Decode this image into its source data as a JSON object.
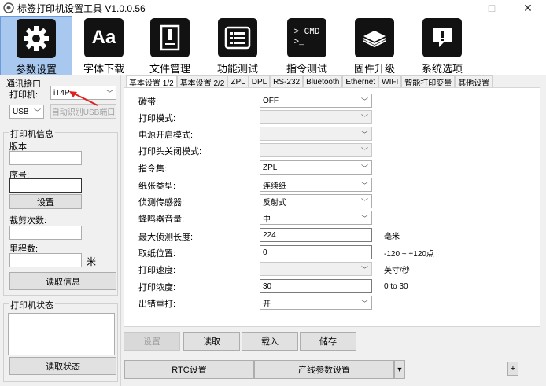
{
  "window": {
    "title": "标签打印机设置工具 V1.0.0.56",
    "minimize": "—",
    "maximize": "□",
    "close": "✕"
  },
  "toolbar": [
    {
      "label": "参数设置",
      "icon": "gear-icon",
      "active": true
    },
    {
      "label": "字体下载",
      "icon": "font-icon"
    },
    {
      "label": "文件管理",
      "icon": "file-icon"
    },
    {
      "label": "功能测试",
      "icon": "list-icon"
    },
    {
      "label": "指令测试",
      "icon": "cmd-icon",
      "icon_text": "> CMD\n>_"
    },
    {
      "label": "固件升级",
      "icon": "chip-icon"
    },
    {
      "label": "系统选项",
      "icon": "alert-icon"
    }
  ],
  "left": {
    "comm_group": "通讯接口",
    "printer_label": "打印机:",
    "printer_value": "iT4P",
    "port_value": "USB",
    "auto_detect": "自动识别USB端口",
    "info_group": "打印机信息",
    "version_label": "版本:",
    "version_value": "",
    "serial_label": "序号:",
    "serial_value": "",
    "set_button": "设置",
    "cut_label": "裁剪次数:",
    "cut_value": "",
    "mileage_label": "里程数:",
    "mileage_value": "",
    "mileage_unit": "米",
    "read_info": "读取信息",
    "status_group": "打印机状态",
    "status_value": "",
    "read_status": "读取状态"
  },
  "tabs": [
    "基本设置 1/2",
    "基本设置 2/2",
    "ZPL",
    "DPL",
    "RS-232",
    "Bluetooth",
    "Ethernet",
    "WIFI",
    "智能打印变量",
    "其他设置"
  ],
  "form": {
    "rows": [
      {
        "label": "碳带:",
        "type": "select",
        "value": "OFF"
      },
      {
        "label": "打印模式:",
        "type": "select-dis",
        "value": ""
      },
      {
        "label": "电源开启模式:",
        "type": "select-dis",
        "value": ""
      },
      {
        "label": "打印头关闭模式:",
        "type": "select-dis",
        "value": ""
      },
      {
        "label": "指令集:",
        "type": "select",
        "value": "ZPL"
      },
      {
        "label": "纸张类型:",
        "type": "select",
        "value": "连续纸"
      },
      {
        "label": "侦测传感器:",
        "type": "select",
        "value": "反射式"
      },
      {
        "label": "蜂鸣器音量:",
        "type": "select",
        "value": "中"
      },
      {
        "label": "最大侦测长度:",
        "type": "input",
        "value": "224",
        "unit": "毫米"
      },
      {
        "label": "取纸位置:",
        "type": "input",
        "value": "0",
        "unit": "-120 ~ +120点"
      },
      {
        "label": "打印速度:",
        "type": "select-dis",
        "value": "",
        "unit": "英寸/秒"
      },
      {
        "label": "打印浓度:",
        "type": "input",
        "value": "30",
        "unit": "0 to 30"
      },
      {
        "label": "出错重打:",
        "type": "select",
        "value": "开"
      }
    ]
  },
  "bottom": {
    "set": "设置",
    "read": "读取",
    "load": "载入",
    "save": "储存",
    "rtc": "RTC设置",
    "production": "产线参数设置",
    "plus": "+"
  }
}
